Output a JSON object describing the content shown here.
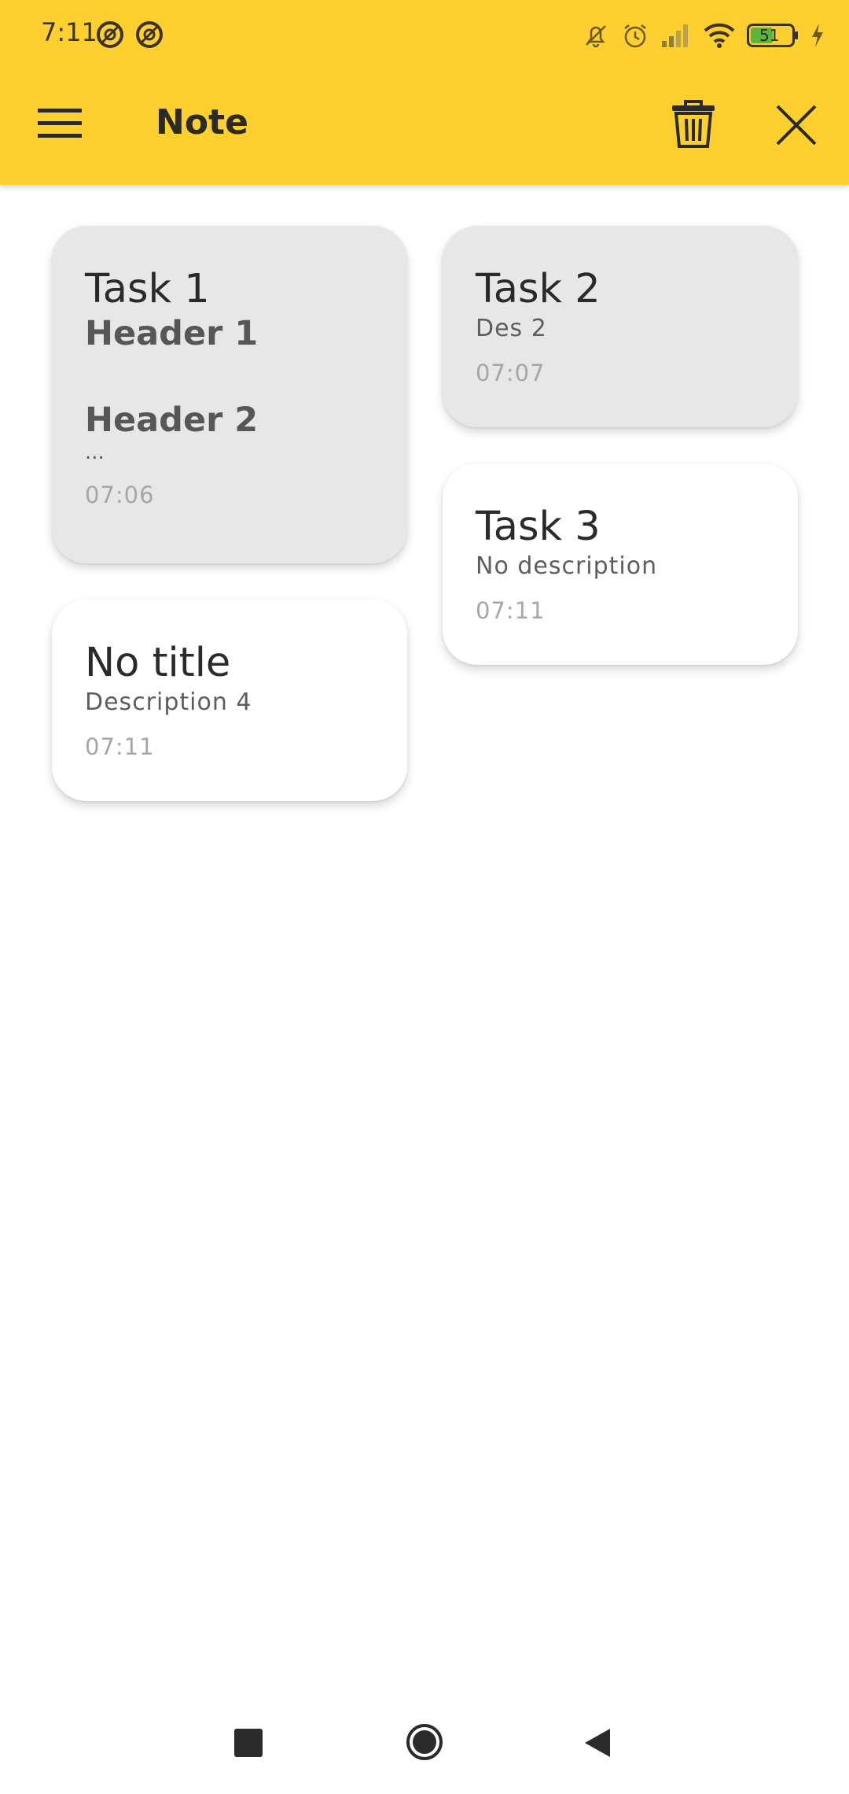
{
  "status": {
    "time": "7:11",
    "battery": "51"
  },
  "app": {
    "title": "Note"
  },
  "notes": [
    {
      "title": "Task 1",
      "header1": "Header 1",
      "header2": "Header 2",
      "ellipsis": "...",
      "time": "07:06"
    },
    {
      "title": "Task 2",
      "description": "Des 2",
      "time": "07:07"
    },
    {
      "title": "Task 3",
      "description": "No description",
      "time": "07:11"
    },
    {
      "title": "No title",
      "description": "Description 4",
      "time": "07:11"
    }
  ],
  "colors": {
    "appbar": "#fdd02f",
    "selected_card": "#e7e7e7",
    "card": "#ffffff"
  },
  "icons": {
    "menu": "menu-icon",
    "delete": "trash-icon",
    "close": "close-icon"
  }
}
